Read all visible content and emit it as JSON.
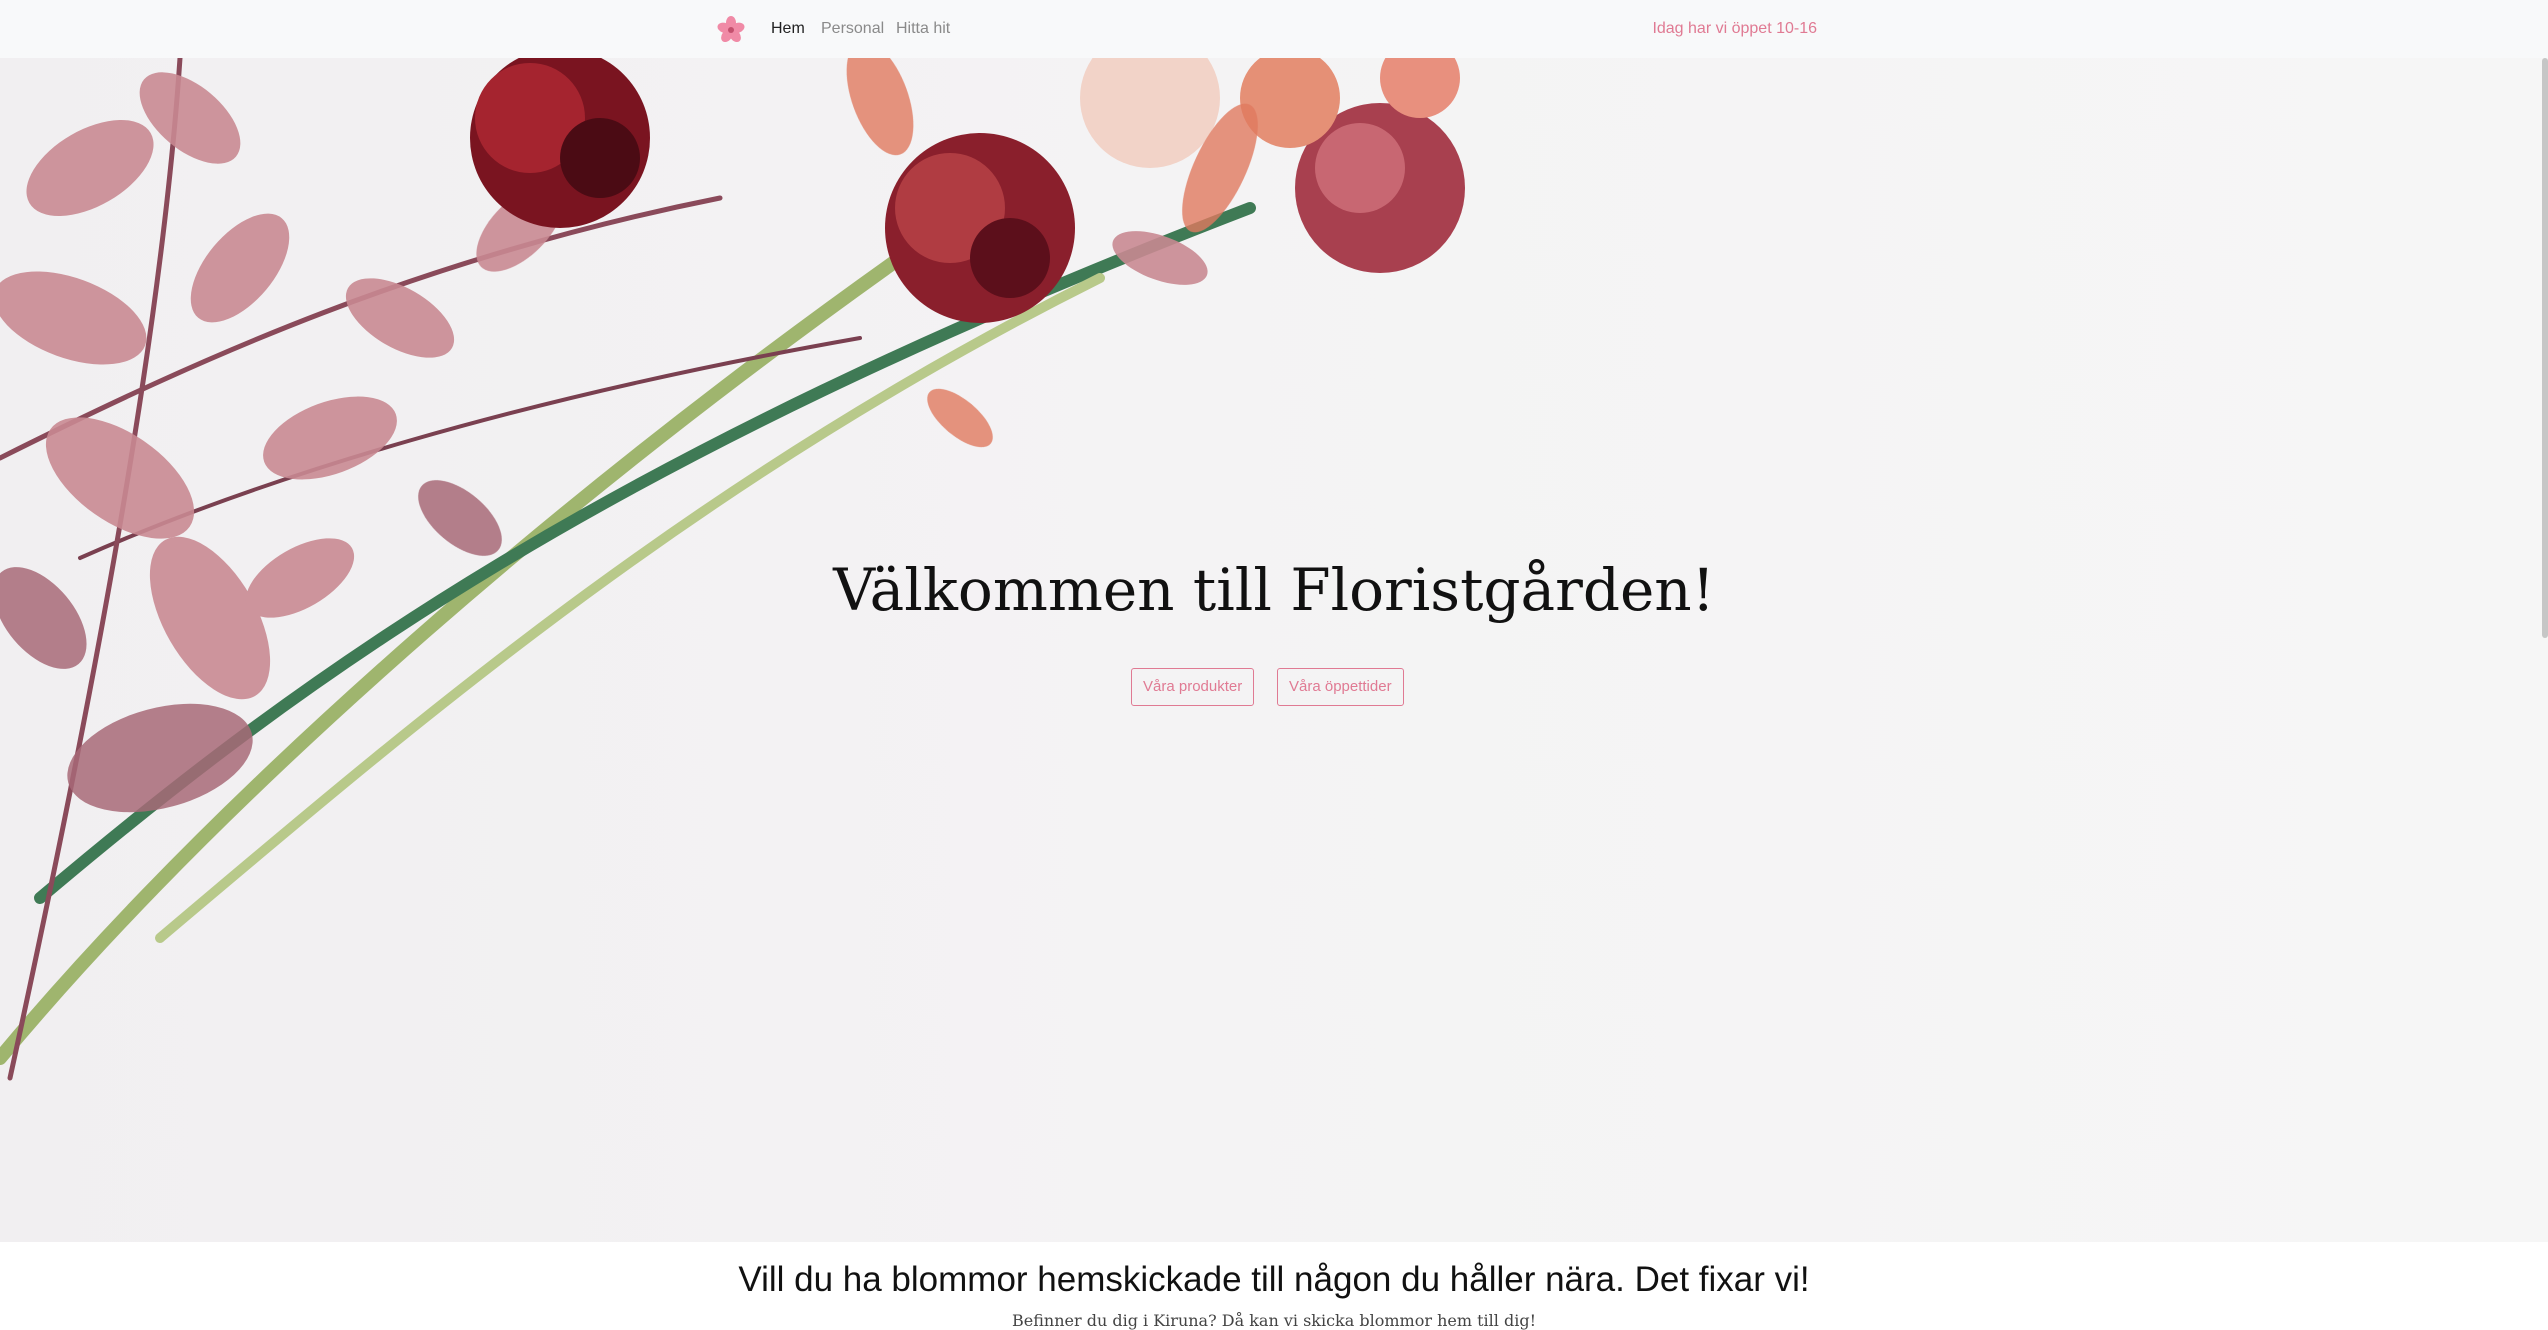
{
  "nav": {
    "brand_icon": "flower-icon",
    "links": [
      {
        "label": "Hem",
        "active": true
      },
      {
        "label": "Personal",
        "active": false
      },
      {
        "label": "Hitta hit",
        "active": false
      }
    ],
    "hours_text": "Idag har vi öppet 10-16"
  },
  "hero": {
    "title": "Välkommen till Floristgården!",
    "buttons": {
      "products": "Våra produkter",
      "hours": "Våra öppettider"
    }
  },
  "section": {
    "title": "Vill du ha blommor hemskickade till någon du håller nära. Det fixar vi!",
    "subtitle": "Befinner du dig i Kiruna? Då kan vi skicka blommor hem till dig!"
  },
  "colors": {
    "accent": "#e07a93",
    "navbar_bg": "#f8f9fa"
  }
}
